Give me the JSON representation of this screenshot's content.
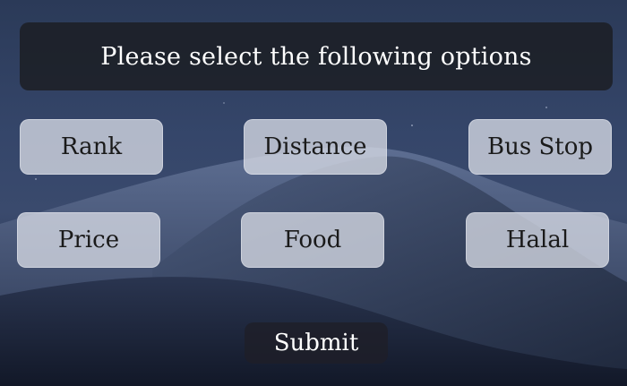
{
  "header": {
    "title": "Please select the following options"
  },
  "options": [
    {
      "label": "Rank"
    },
    {
      "label": "Distance"
    },
    {
      "label": "Bus Stop"
    },
    {
      "label": "Price"
    },
    {
      "label": "Food"
    },
    {
      "label": "Halal"
    }
  ],
  "submit": {
    "label": "Submit"
  }
}
